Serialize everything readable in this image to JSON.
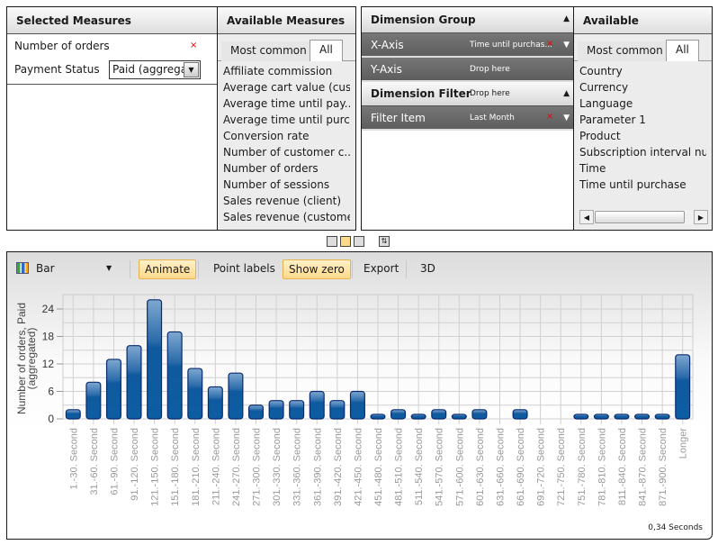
{
  "selected_measures": {
    "title": "Selected Measures",
    "items": [
      {
        "label": "Number of orders",
        "remove_icon": "×"
      }
    ],
    "filter_label": "Payment Status",
    "filter_value": "Paid (aggrega"
  },
  "available_measures": {
    "title": "Available Measures",
    "tabs": [
      "Most common",
      "All"
    ],
    "items": [
      "Affiliate commission",
      "Average cart value (cus...",
      "Average time until pay...",
      "Average time until purc...",
      "Conversion rate",
      "Number of customer c...",
      "Number of orders",
      "Number of sessions",
      "Sales revenue (client)",
      "Sales revenue (customer)"
    ]
  },
  "dimension_group": {
    "title": "Dimension Group",
    "x_axis_label": "X-Axis",
    "x_axis_value": "Time until purchas...",
    "y_axis_label": "Y-Axis",
    "y_axis_value": "Drop here",
    "filter_title": "Dimension Filter",
    "filter_drop": "Drop here",
    "filter_item_label": "Filter Item",
    "filter_item_value": "Last Month",
    "remove_icon": "×"
  },
  "available_dimensions": {
    "title": "Available Dimensions",
    "tabs": [
      "Most common",
      "All"
    ],
    "items": [
      "Country",
      "Currency",
      "Language",
      "Parameter 1",
      "Product",
      "Subscription interval numbe",
      "Time",
      "Time until purchase"
    ]
  },
  "toolbar": {
    "chart_type": "Bar",
    "animate": "Animate",
    "point_labels": "Point labels",
    "show_zero": "Show zero",
    "export": "Export",
    "three_d": "3D"
  },
  "footer": {
    "timing": "0,34 Seconds"
  },
  "chart_data": {
    "type": "bar",
    "title": "",
    "xlabel": "",
    "ylabel": "Number of orders, Paid (aggregated)",
    "ylim": [
      0,
      26
    ],
    "yticks": [
      0,
      6,
      12,
      18,
      24
    ],
    "grid": true,
    "categories": [
      "1.-30. Second",
      "31.-60. Second",
      "61.-90. Second",
      "91.-120. Second",
      "121.-150. Second",
      "151.-180. Second",
      "181.-210. Second",
      "211.-240. Second",
      "241.-270. Second",
      "271.-300. Second",
      "301.-330. Second",
      "331.-360. Second",
      "361.-390. Second",
      "391.-420. Second",
      "421.-450. Second",
      "451.-480. Second",
      "481.-510. Second",
      "511.-540. Second",
      "541.-570. Second",
      "571.-600. Second",
      "601.-630. Second",
      "631.-660. Second",
      "661.-690. Second",
      "691.-720. Second",
      "721.-750. Second",
      "751.-780. Second",
      "781.-810. Second",
      "811.-840. Second",
      "841.-870. Second",
      "871.-900. Second",
      "Longer"
    ],
    "values": [
      2,
      8,
      13,
      16,
      26,
      19,
      11,
      7,
      10,
      3,
      4,
      4,
      6,
      4,
      6,
      1,
      2,
      1,
      2,
      1,
      2,
      0,
      2,
      0,
      0,
      1,
      1,
      1,
      1,
      1,
      14
    ]
  }
}
